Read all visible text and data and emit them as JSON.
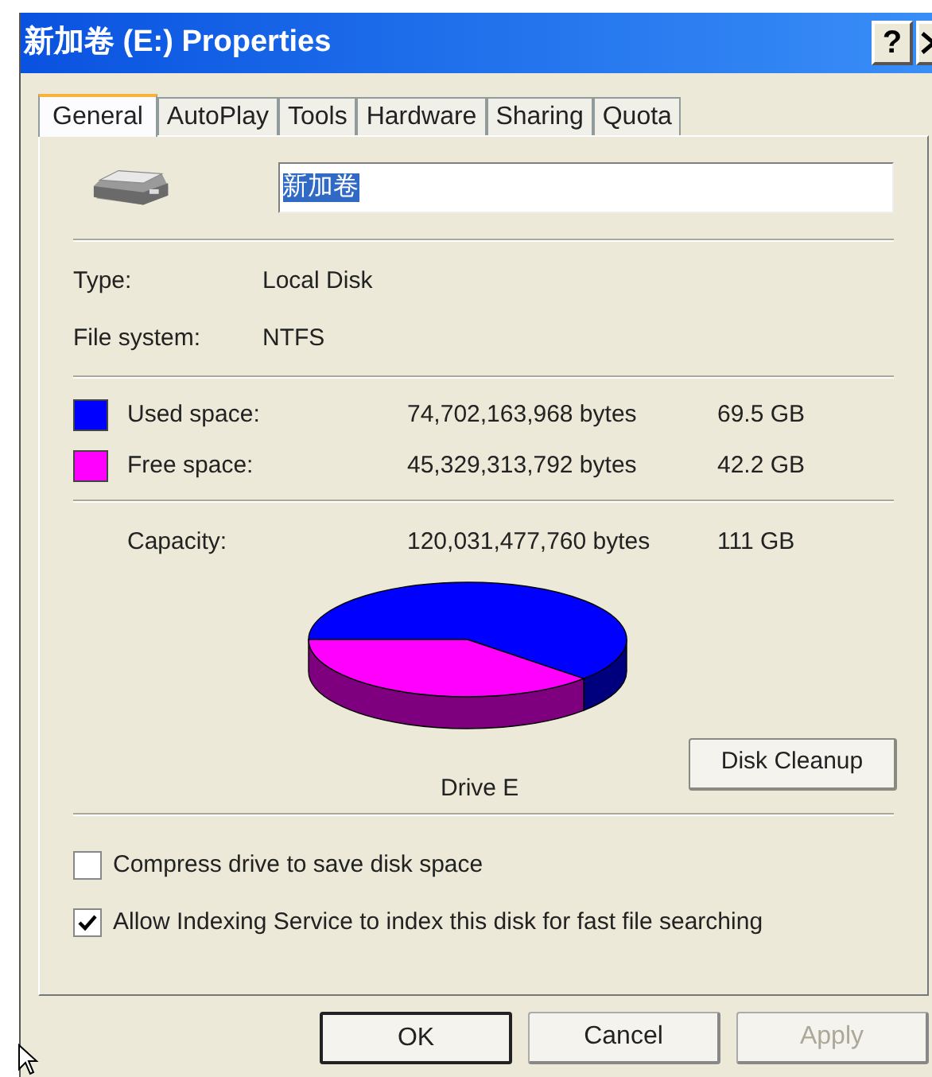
{
  "window": {
    "title": "新加卷 (E:) Properties",
    "help_button": "?"
  },
  "tabs": [
    {
      "label": "General",
      "selected": true
    },
    {
      "label": "AutoPlay",
      "selected": false
    },
    {
      "label": "Tools",
      "selected": false
    },
    {
      "label": "Hardware",
      "selected": false
    },
    {
      "label": "Sharing",
      "selected": false
    },
    {
      "label": "Quota",
      "selected": false
    }
  ],
  "drive": {
    "name": "新加卷",
    "name_selected": true
  },
  "info": [
    {
      "label": "Type:",
      "value": "Local Disk"
    },
    {
      "label": "File system:",
      "value": "NTFS"
    }
  ],
  "space": [
    {
      "label": "Used space:",
      "bytes": "74,702,163,968 bytes",
      "size": "69.5 GB",
      "color": "#0000ff"
    },
    {
      "label": "Free space:",
      "bytes": "45,329,313,792 bytes",
      "size": "42.2 GB",
      "color": "#ff00ff"
    }
  ],
  "capacity": {
    "label": "Capacity:",
    "bytes": "120,031,477,760 bytes",
    "size": "111 GB"
  },
  "drive_label": "Drive E",
  "cleanup_button": "Disk Cleanup",
  "options": [
    {
      "label": "Compress drive to save disk space",
      "checked": false
    },
    {
      "label": "Allow Indexing Service to index this disk for fast file searching",
      "checked": true
    }
  ],
  "buttons": [
    {
      "label": "OK",
      "default": true,
      "disabled": false
    },
    {
      "label": "Cancel",
      "default": false,
      "disabled": false
    },
    {
      "label": "Apply",
      "default": false,
      "disabled": true
    }
  ]
}
